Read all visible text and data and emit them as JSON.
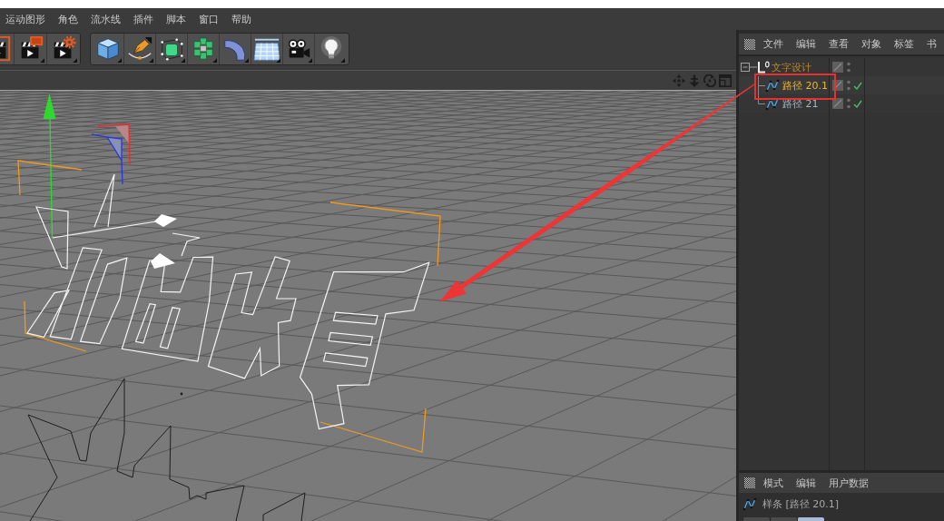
{
  "menu_bar": {
    "items": [
      "运动图形",
      "角色",
      "流水线",
      "插件",
      "脚本",
      "窗口",
      "帮助"
    ]
  },
  "toolbar": {
    "groups": [
      {
        "tools": [
          {
            "kind": "render_region"
          },
          {
            "kind": "render_view"
          },
          {
            "kind": "render_settings"
          }
        ]
      },
      {
        "tools": [
          {
            "kind": "cube"
          },
          {
            "kind": "pen"
          },
          {
            "kind": "subdivision"
          },
          {
            "kind": "cloner"
          },
          {
            "kind": "bend"
          },
          {
            "kind": "floor"
          },
          {
            "kind": "camera"
          },
          {
            "kind": "light"
          }
        ]
      }
    ]
  },
  "object_manager": {
    "menu": [
      "文件",
      "编辑",
      "查看",
      "对象",
      "标签",
      "书"
    ],
    "objects": [
      {
        "name": "文字设计",
        "kind": "null",
        "selected": true,
        "active": false,
        "expanded": true,
        "children": [
          {
            "name": "路径 20.1",
            "kind": "spline",
            "selected": true,
            "active": true,
            "enabled": true
          },
          {
            "name": "路径 21",
            "kind": "spline",
            "selected": false,
            "active": false,
            "enabled": true
          }
        ]
      }
    ]
  },
  "attribute_manager": {
    "menu": [
      "模式",
      "编辑",
      "用户数据"
    ],
    "title": "样条 [路径 20.1]",
    "tabs": [
      {
        "selected": false
      },
      {
        "selected": false
      },
      {
        "selected": true
      }
    ]
  }
}
